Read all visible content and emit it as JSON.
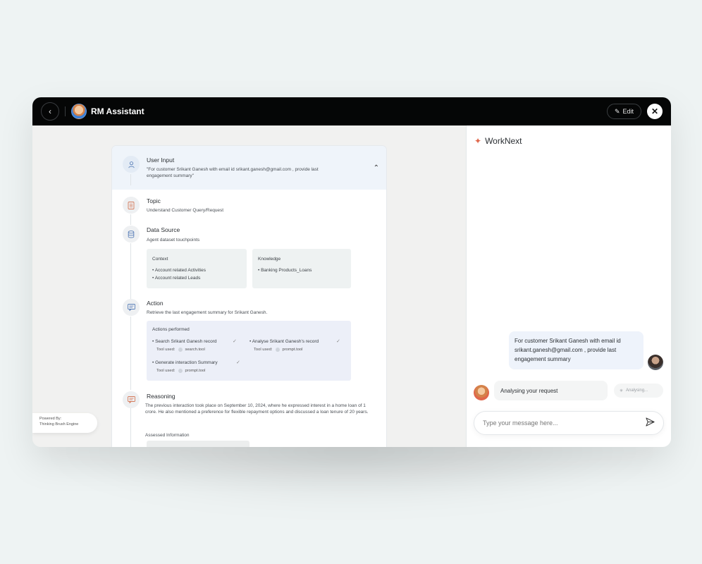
{
  "titlebar": {
    "title": "RM Assistant",
    "edit_label": "Edit"
  },
  "powered_by": {
    "line1": "Powered By:",
    "line2": "Thinking Brush Engine"
  },
  "flow": {
    "user_input": {
      "title": "User Input",
      "text": "\"For customer Srikant Ganesh with email id srikant.ganesh@gmail.com , provide last engagement summary\""
    },
    "topic": {
      "title": "Topic",
      "text": "Understand Customer Query/Request"
    },
    "data_source": {
      "title": "Data Source",
      "text": "Agent dataset touchpoints",
      "context_title": "Context",
      "context_items": [
        "• Account related Activities",
        "• Account related Leads"
      ],
      "knowledge_title": "Knowledge",
      "knowledge_items": [
        "• Banking Products_Loans"
      ]
    },
    "action": {
      "title": "Action",
      "text": "Retrieve the last engagement summary for Srikant Ganesh.",
      "performed_title": "Actions performed",
      "tool_used_label": "Tool used:",
      "items": [
        {
          "label": "• Search Srikant Ganesh record",
          "tool": "search.tool"
        },
        {
          "label": "• Analyse Srikant Ganesh's record",
          "tool": "prompt.tool"
        },
        {
          "label": "• Generate interaction Summary",
          "tool": "prompt.tool"
        }
      ]
    },
    "reasoning": {
      "title": "Reasoning",
      "text": "The previous interaction took place on September 10, 2024, where he expressed interest in a home loan of 1 crore. He also mentioned a preference for flexible repayment options and discussed a loan tenure of 20 years.",
      "assessed_title": "Assessed Information"
    }
  },
  "chat": {
    "title": "WorkNext",
    "user_message": "For customer Srikant Ganesh with email id srikant.ganesh@gmail.com , provide last engagement summary",
    "bot_message": "Analysing your request",
    "status": "Analysing...",
    "input_placeholder": "Type your message here..."
  },
  "colors": {
    "titlebar_bg": "#050606",
    "accent_star": "#e0674b",
    "user_bubble": "#eef3fb",
    "actions_box": "#eceff8"
  }
}
